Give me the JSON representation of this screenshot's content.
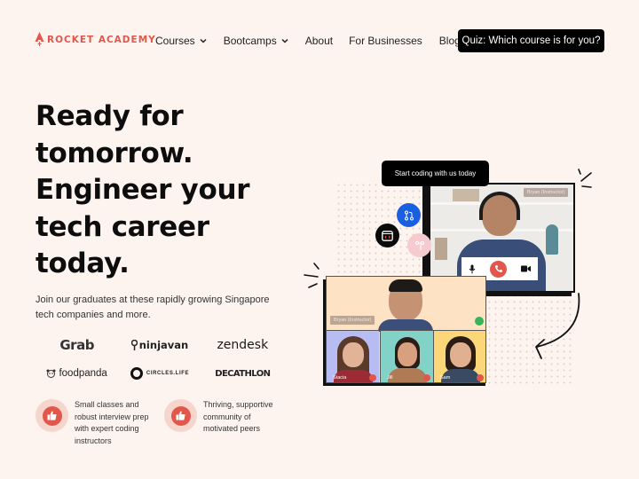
{
  "nav": {
    "logo_text": "ROCKET ACADEMY",
    "items": [
      {
        "label": "Courses",
        "has_dropdown": true
      },
      {
        "label": "Bootcamps",
        "has_dropdown": true
      },
      {
        "label": "About",
        "has_dropdown": false
      },
      {
        "label": "For Businesses",
        "has_dropdown": false
      },
      {
        "label": "Blog",
        "has_dropdown": false
      }
    ],
    "cta_label": "Quiz: Which course is for you?"
  },
  "hero": {
    "headline_lines": [
      "Ready for",
      "tomorrow.",
      "Engineer your",
      "tech career",
      "today."
    ],
    "subtext": "Join our graduates at these rapidly growing Singapore tech companies and more.",
    "companies": [
      "Grab",
      "ninjavan",
      "zendesk",
      "foodpanda",
      "CIRCLES.LIFE",
      "DECATHLON"
    ],
    "features": [
      {
        "icon": "thumbs-up-icon",
        "text": "Small classes and robust interview prep with expert coding instructors"
      },
      {
        "icon": "thumbs-up-icon",
        "text": "Thriving, supportive community of motivated peers"
      }
    ]
  },
  "illustration": {
    "tooltip": "Start coding with us today",
    "instructor_tag": "Bryan (Instructor)",
    "grid_instructor_tag": "Bryan (Instructor)",
    "students": [
      "Stacia",
      "Jill",
      "Sam"
    ]
  },
  "colors": {
    "brand": "#e2574c",
    "background": "#fdf4ef",
    "cta_bg": "#000000",
    "accent_blue": "#1a5fe0"
  }
}
